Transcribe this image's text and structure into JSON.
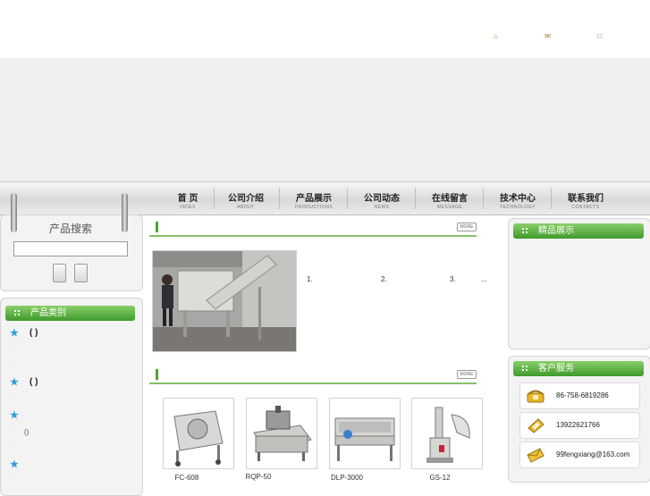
{
  "header": {
    "icons": [
      "home-icon",
      "mail-icon",
      "chat-icon"
    ]
  },
  "nav": {
    "items": [
      {
        "cn": "首 页",
        "en": "INDEX"
      },
      {
        "cn": "公司介绍",
        "en": "ABOUT"
      },
      {
        "cn": "产品展示",
        "en": "PRODUCTIONS"
      },
      {
        "cn": "公司动态",
        "en": "NEWS"
      },
      {
        "cn": "在线留言",
        "en": "MESSAGE"
      },
      {
        "cn": "技术中心",
        "en": "TECHNOLOGY"
      },
      {
        "cn": "联系我们",
        "en": "CONTACTS"
      }
    ]
  },
  "search": {
    "title": "产品搜索",
    "input_value": ""
  },
  "categories": {
    "title": "产品类别",
    "entries": [
      {
        "main": "( )",
        "subs": [
          "",
          ""
        ]
      },
      {
        "main": "( )",
        "subs": [
          ""
        ]
      },
      {
        "main": "",
        "subs": [
          "()",
          ""
        ]
      },
      {
        "main": "",
        "subs": [
          ""
        ]
      }
    ]
  },
  "news": {
    "more_label": "MORE",
    "list": [
      "1.",
      "2.",
      "3.",
      "..."
    ]
  },
  "products": {
    "more_label": "MORE",
    "items": [
      {
        "name": "FC-608"
      },
      {
        "name": "RQP-50"
      },
      {
        "name": "DLP-3000"
      },
      {
        "name": "GS-12"
      }
    ]
  },
  "featured": {
    "title": "精品展示"
  },
  "service": {
    "title": "客户服务",
    "phone": "86-758-6819286",
    "mobile": "13922621766",
    "email": "99fengxiang@163.com"
  },
  "colors": {
    "accent_green": "#3f9a2c",
    "star_blue": "#2ea0dc"
  }
}
